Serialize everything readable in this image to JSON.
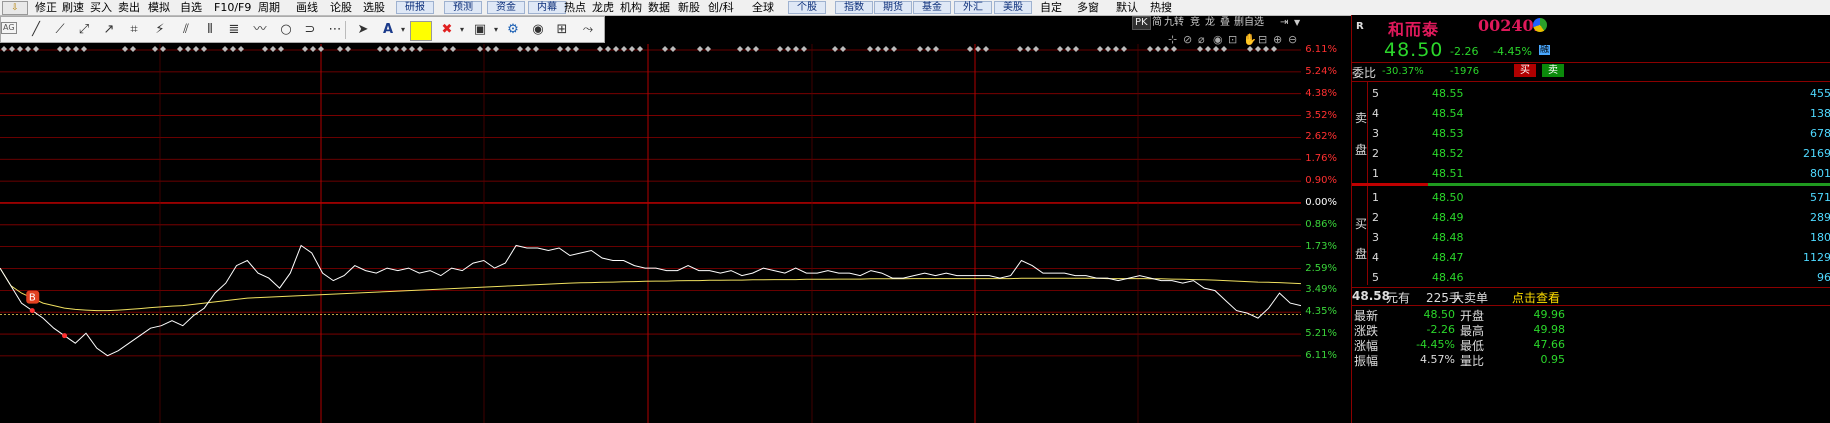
{
  "menu": {
    "home_label": "⇩",
    "items": [
      {
        "label": "修正",
        "boxed": false
      },
      {
        "label": "刷速",
        "boxed": false
      },
      {
        "label": "买入",
        "boxed": false
      },
      {
        "label": "卖出",
        "boxed": false
      },
      {
        "label": "模拟",
        "boxed": false
      },
      {
        "label": "自选",
        "boxed": false
      },
      {
        "label": "F10/F9",
        "boxed": false
      },
      {
        "label": "周期",
        "boxed": false
      },
      {
        "label": "画线",
        "boxed": false
      },
      {
        "label": "论股",
        "boxed": false
      },
      {
        "label": "选股",
        "boxed": false
      },
      {
        "label": "研报",
        "boxed": true
      },
      {
        "label": "预测",
        "boxed": true
      },
      {
        "label": "资金",
        "boxed": true
      },
      {
        "label": "内幕",
        "boxed": true
      },
      {
        "label": "热点",
        "boxed": false
      },
      {
        "label": "龙虎",
        "boxed": false
      },
      {
        "label": "机构",
        "boxed": false
      },
      {
        "label": "数据",
        "boxed": false
      },
      {
        "label": "新股",
        "boxed": false
      },
      {
        "label": "创/科",
        "boxed": false
      },
      {
        "label": "全球",
        "boxed": false
      },
      {
        "label": "个股",
        "boxed": true
      },
      {
        "label": "指数",
        "boxed": true
      },
      {
        "label": "期货",
        "boxed": true
      },
      {
        "label": "基金",
        "boxed": true
      },
      {
        "label": "外汇",
        "boxed": true
      },
      {
        "label": "美股",
        "boxed": true
      },
      {
        "label": "自定",
        "boxed": false
      },
      {
        "label": "多窗",
        "boxed": false
      },
      {
        "label": "默认",
        "boxed": false
      },
      {
        "label": "热搜",
        "boxed": false
      }
    ]
  },
  "toolbar": {
    "ag_label": "AG",
    "text_tool": "A",
    "tools": [
      {
        "name": "line-segment-icon",
        "glyph": "╱"
      },
      {
        "name": "ray-icon",
        "glyph": "⟋"
      },
      {
        "name": "double-arrow-icon",
        "glyph": "⤢"
      },
      {
        "name": "arrow-icon",
        "glyph": "↗"
      },
      {
        "name": "crop-icon",
        "glyph": "⌗"
      },
      {
        "name": "gann-fan-icon",
        "glyph": "⚡"
      },
      {
        "name": "parallel-lines-icon",
        "glyph": "⫽"
      },
      {
        "name": "vertical-lines-icon",
        "glyph": "⦀"
      },
      {
        "name": "fibonacci-icon",
        "glyph": "≣"
      },
      {
        "name": "wave-icon",
        "glyph": "〰"
      },
      {
        "name": "circle-icon",
        "glyph": "○"
      },
      {
        "name": "arc-icon",
        "glyph": "⊃"
      },
      {
        "name": "more-icon",
        "glyph": "⋯"
      },
      {
        "name": "cursor-icon",
        "glyph": "➤"
      },
      {
        "name": "delete-icon",
        "glyph": "✖"
      },
      {
        "name": "save-drawing-icon",
        "glyph": "▣"
      },
      {
        "name": "settings-icon",
        "glyph": "⚙"
      },
      {
        "name": "eye-icon",
        "glyph": "◉"
      },
      {
        "name": "grid-icon",
        "glyph": "⊞"
      },
      {
        "name": "share-icon",
        "glyph": "⤳"
      }
    ],
    "colors": {
      "fill": "#ffff00",
      "delete": "#e02020",
      "settings": "#1a5fb4"
    }
  },
  "chart_header": {
    "pk": "PK",
    "jian": "简",
    "jiuzhuan": "九转",
    "jing": "竞",
    "long": "龙",
    "die": "叠",
    "zixuan": "删自选",
    "pin": "⇥",
    "tools": [
      "⊹",
      "⊘",
      "⌀",
      "◉",
      "⊡",
      "✋",
      "⊟",
      "⊕",
      "⊖"
    ]
  },
  "chart_data": {
    "type": "line",
    "y_labels": [
      {
        "text": "6.11%",
        "color": "#ff3030"
      },
      {
        "text": "5.24%",
        "color": "#ff3030"
      },
      {
        "text": "4.38%",
        "color": "#ff3030"
      },
      {
        "text": "3.52%",
        "color": "#ff3030"
      },
      {
        "text": "2.62%",
        "color": "#ff3030"
      },
      {
        "text": "1.76%",
        "color": "#ff3030"
      },
      {
        "text": "0.90%",
        "color": "#ff3030"
      },
      {
        "text": "0.00%",
        "color": "#ffffff"
      },
      {
        "text": "0.86%",
        "color": "#3ad43a"
      },
      {
        "text": "1.73%",
        "color": "#3ad43a"
      },
      {
        "text": "2.59%",
        "color": "#3ad43a"
      },
      {
        "text": "3.49%",
        "color": "#3ad43a"
      },
      {
        "text": "4.35%",
        "color": "#3ad43a"
      },
      {
        "text": "5.21%",
        "color": "#3ad43a"
      },
      {
        "text": "6.11%",
        "color": "#3ad43a"
      }
    ],
    "price_pct": [
      -2.6,
      -3.3,
      -4.0,
      -4.3,
      -4.6,
      -5.0,
      -5.3,
      -5.6,
      -5.2,
      -5.8,
      -6.1,
      -5.9,
      -5.6,
      -5.3,
      -5.0,
      -4.9,
      -4.7,
      -4.9,
      -4.5,
      -4.2,
      -3.6,
      -3.2,
      -2.5,
      -2.3,
      -2.8,
      -3.0,
      -3.4,
      -2.8,
      -1.7,
      -2.0,
      -2.8,
      -3.1,
      -2.9,
      -2.5,
      -2.7,
      -2.8,
      -2.6,
      -2.7,
      -2.6,
      -2.8,
      -2.7,
      -2.9,
      -2.6,
      -2.7,
      -2.4,
      -2.3,
      -2.6,
      -2.4,
      -1.7,
      -1.8,
      -1.8,
      -1.9,
      -1.8,
      -2.1,
      -2.0,
      -1.9,
      -2.2,
      -2.3,
      -2.3,
      -2.5,
      -2.6,
      -2.6,
      -2.7,
      -2.7,
      -2.5,
      -2.7,
      -2.7,
      -2.8,
      -2.7,
      -2.9,
      -2.8,
      -2.6,
      -2.7,
      -2.8,
      -2.6,
      -2.8,
      -2.8,
      -2.7,
      -2.8,
      -2.8,
      -2.9,
      -2.7,
      -2.8,
      -3.0,
      -3.0,
      -2.9,
      -2.8,
      -2.9,
      -2.8,
      -2.9,
      -2.9,
      -2.9,
      -2.9,
      -3.0,
      -2.9,
      -2.3,
      -2.5,
      -2.8,
      -2.8,
      -2.8,
      -2.9,
      -2.9,
      -3.0,
      -3.0,
      -3.1,
      -3.0,
      -2.9,
      -3.0,
      -3.1,
      -3.1,
      -3.2,
      -3.1,
      -3.4,
      -3.5,
      -3.9,
      -4.3,
      -4.4,
      -4.6,
      -4.2,
      -3.6,
      -4.0,
      -4.1
    ],
    "avg_pct": [
      -2.6,
      -3.3,
      -3.6,
      -3.8,
      -4.0,
      -4.1,
      -4.2,
      -4.25,
      -4.28,
      -4.3,
      -4.3,
      -4.28,
      -4.25,
      -4.22,
      -4.18,
      -4.15,
      -4.12,
      -4.1,
      -4.05,
      -4.0,
      -3.95,
      -3.9,
      -3.85,
      -3.8,
      -3.78,
      -3.76,
      -3.74,
      -3.72,
      -3.7,
      -3.68,
      -3.66,
      -3.64,
      -3.62,
      -3.6,
      -3.58,
      -3.56,
      -3.54,
      -3.52,
      -3.5,
      -3.48,
      -3.46,
      -3.44,
      -3.42,
      -3.4,
      -3.38,
      -3.36,
      -3.34,
      -3.32,
      -3.3,
      -3.28,
      -3.26,
      -3.24,
      -3.22,
      -3.2,
      -3.19,
      -3.18,
      -3.17,
      -3.16,
      -3.15,
      -3.14,
      -3.13,
      -3.12,
      -3.12,
      -3.11,
      -3.1,
      -3.1,
      -3.09,
      -3.09,
      -3.08,
      -3.08,
      -3.07,
      -3.07,
      -3.06,
      -3.06,
      -3.06,
      -3.05,
      -3.05,
      -3.05,
      -3.04,
      -3.04,
      -3.04,
      -3.03,
      -3.03,
      -3.03,
      -3.03,
      -3.02,
      -3.02,
      -3.02,
      -3.02,
      -3.02,
      -3.02,
      -3.02,
      -3.02,
      -3.02,
      -3.02,
      -3.01,
      -3.01,
      -3.01,
      -3.01,
      -3.01,
      -3.01,
      -3.01,
      -3.01,
      -3.02,
      -3.02,
      -3.02,
      -3.02,
      -3.03,
      -3.03,
      -3.04,
      -3.05,
      -3.06,
      -3.07,
      -3.08,
      -3.1,
      -3.12,
      -3.14,
      -3.16,
      -3.17,
      -3.18,
      -3.2,
      -3.22
    ],
    "reference_pct": -4.45,
    "marker": {
      "label": "B",
      "index": 3
    },
    "colors": {
      "price": "#ffffff",
      "avg": "#f0e060",
      "grid": "#8b0000",
      "reference": "#ffe060",
      "marker": "#e04020"
    }
  },
  "quote": {
    "corner": "R",
    "name": "和而泰",
    "code": "002402",
    "price": "48.50",
    "change": "-2.26",
    "change_pct": "-4.45%",
    "rong": "融",
    "weibi_label": "委比",
    "weibi": "-30.37%",
    "weicha": "-1976",
    "buy_btn": "买",
    "sell_btn": "卖",
    "sell_label": [
      "卖",
      "盘"
    ],
    "buy_label": [
      "买",
      "盘"
    ],
    "asks": [
      {
        "n": "5",
        "price": "48.55",
        "vol": "455"
      },
      {
        "n": "4",
        "price": "48.54",
        "vol": "138"
      },
      {
        "n": "3",
        "price": "48.53",
        "vol": "678"
      },
      {
        "n": "2",
        "price": "48.52",
        "vol": "2169"
      },
      {
        "n": "1",
        "price": "48.51",
        "vol": "801"
      }
    ],
    "bids": [
      {
        "n": "1",
        "price": "48.50",
        "vol": "571"
      },
      {
        "n": "2",
        "price": "48.49",
        "vol": "289"
      },
      {
        "n": "3",
        "price": "48.48",
        "vol": "180"
      },
      {
        "n": "4",
        "price": "48.47",
        "vol": "1129"
      },
      {
        "n": "5",
        "price": "48.46",
        "vol": "96"
      }
    ],
    "tick_price": "48.58",
    "tick_unit": "元有",
    "tick_vol": "225手",
    "tick_big": "大卖单",
    "tick_link": "点击查看",
    "stats": [
      {
        "l1": "最新",
        "v1": "48.50",
        "l2": "开盘",
        "v2": "49.96"
      },
      {
        "l1": "涨跌",
        "v1": "-2.26",
        "l2": "最高",
        "v2": "49.98"
      },
      {
        "l1": "涨幅",
        "v1": "-4.45%",
        "l2": "最低",
        "v2": "47.66"
      },
      {
        "l1": "振幅",
        "v1": "4.57%",
        "l2": "量比",
        "v2": "0.95"
      }
    ]
  }
}
